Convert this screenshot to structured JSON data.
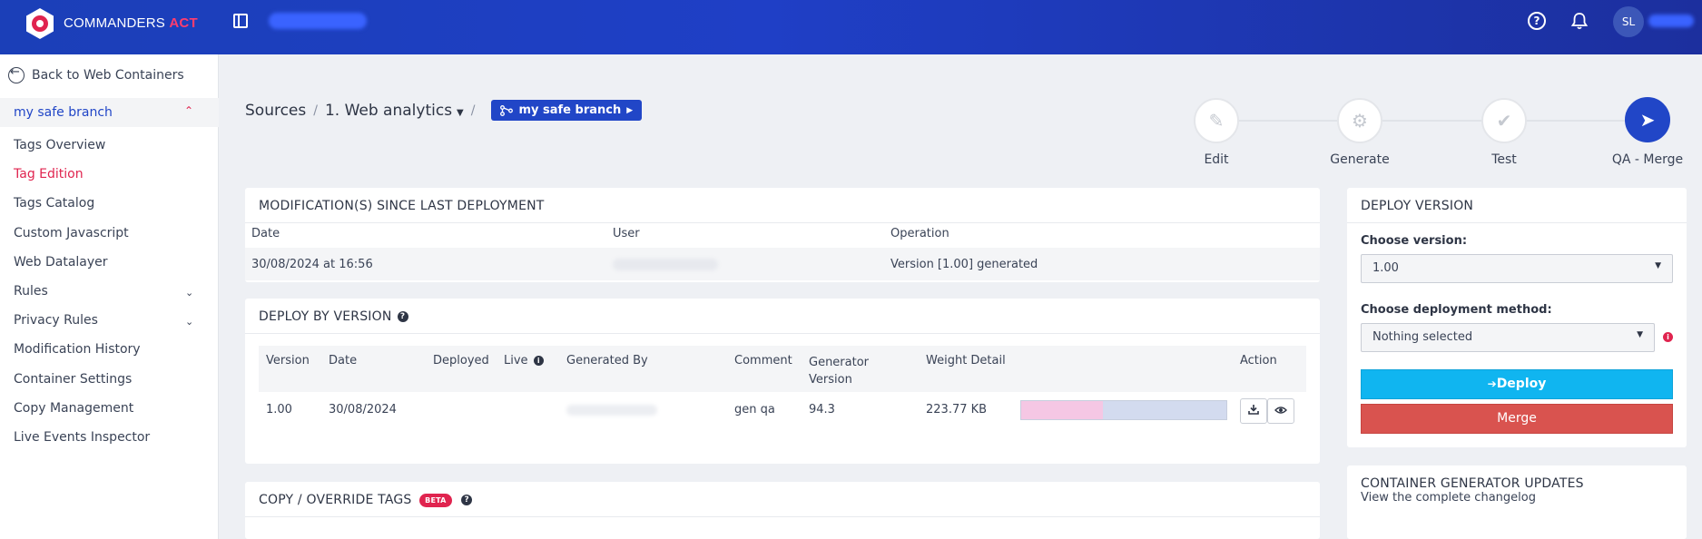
{
  "topbar": {
    "brand_name": "COMMANDERS",
    "brand_accent": "ACT",
    "help_glyph": "?",
    "avatar_initials": "SL",
    "colors": {
      "bar": "#1f3fc6",
      "accent": "#ff3d6e"
    }
  },
  "sidebar": {
    "back_label": "Back to Web Containers",
    "branch_label": "my safe branch",
    "items": [
      {
        "label": "Tags Overview",
        "active": false,
        "expandable": false
      },
      {
        "label": "Tag Edition",
        "active": true,
        "expandable": false
      },
      {
        "label": "Tags Catalog",
        "active": false,
        "expandable": false
      },
      {
        "label": "Custom Javascript",
        "active": false,
        "expandable": false
      },
      {
        "label": "Web Datalayer",
        "active": false,
        "expandable": false
      },
      {
        "label": "Rules",
        "active": false,
        "expandable": true
      },
      {
        "label": "Privacy Rules",
        "active": false,
        "expandable": true
      },
      {
        "label": "Modification History",
        "active": false,
        "expandable": false
      },
      {
        "label": "Container Settings",
        "active": false,
        "expandable": false
      },
      {
        "label": "Copy Management",
        "active": false,
        "expandable": false
      },
      {
        "label": "Live Events Inspector",
        "active": false,
        "expandable": false
      }
    ]
  },
  "breadcrumb": {
    "root": "Sources",
    "container": "1. Web analytics",
    "branch": "my safe branch"
  },
  "stepper": {
    "steps": [
      {
        "label": "Edit",
        "icon": "pencil-icon",
        "current": false
      },
      {
        "label": "Generate",
        "icon": "gears-icon",
        "current": false
      },
      {
        "label": "Test",
        "icon": "check-circle-icon",
        "current": false
      },
      {
        "label": "QA - Merge",
        "icon": "paper-plane-icon",
        "current": true
      }
    ]
  },
  "modifications": {
    "title": "MODIFICATION(S) SINCE LAST DEPLOYMENT",
    "columns": [
      "Date",
      "User",
      "Operation"
    ],
    "rows": [
      {
        "date": "30/08/2024 at 16:56",
        "user": "",
        "operation": "Version [1.00] generated"
      }
    ]
  },
  "deploy_by_version": {
    "title": "DEPLOY BY VERSION",
    "columns": {
      "version": "Version",
      "date": "Date",
      "deployed": "Deployed",
      "live": "Live",
      "generated_by": "Generated By",
      "comment": "Comment",
      "generator_version_1": "Generator",
      "generator_version_2": "Version",
      "weight_detail": "Weight Detail",
      "action": "Action"
    },
    "rows": [
      {
        "version": "1.00",
        "date": "30/08/2024",
        "deployed": "",
        "live": "",
        "generated_by": "",
        "comment": "gen qa",
        "generator_version": "94.3",
        "weight": "223.77 KB",
        "weight_split": 0.4
      }
    ]
  },
  "copy_override": {
    "title": "COPY / OVERRIDE TAGS",
    "badge": "BETA"
  },
  "deploy_version": {
    "title": "DEPLOY VERSION",
    "version_label": "Choose version:",
    "version_value": "1.00",
    "method_label": "Choose deployment method:",
    "method_value": "Nothing selected",
    "deploy_button": "Deploy",
    "merge_button": "Merge"
  },
  "generator_updates": {
    "title": "CONTAINER GENERATOR UPDATES",
    "link": "View the complete changelog"
  }
}
